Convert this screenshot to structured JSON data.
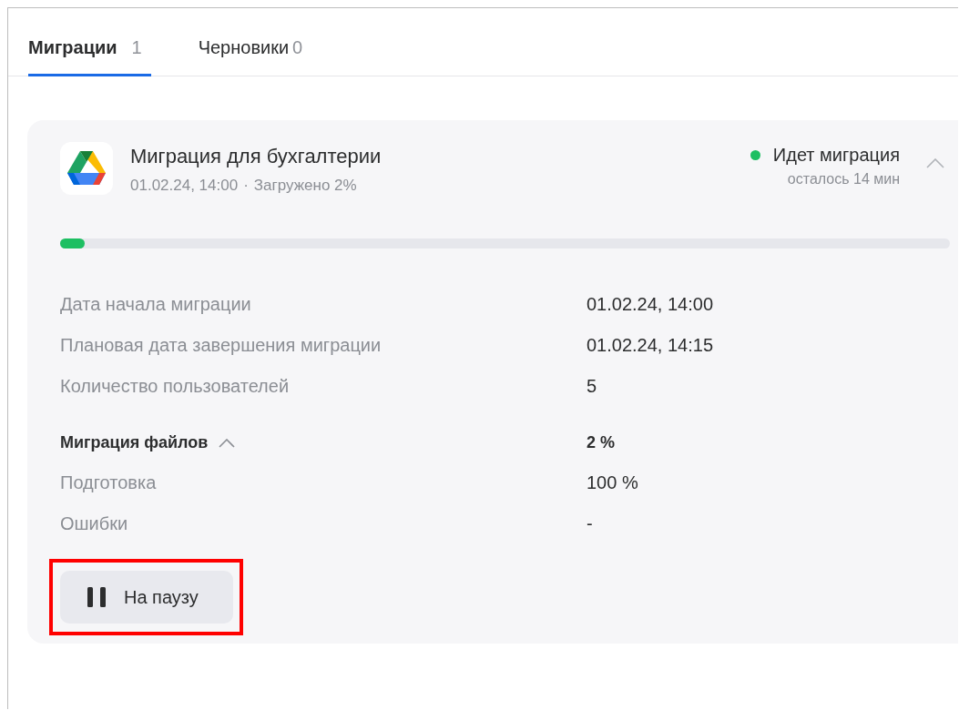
{
  "tabs": [
    {
      "label": "Миграции",
      "count": "1",
      "selected": true
    },
    {
      "label": "Черновики",
      "count": "0",
      "selected": false
    }
  ],
  "migration": {
    "title": "Миграция для бухгалтерии",
    "date": "01.02.24, 14:00",
    "separator": "·",
    "uploaded": "Загружено 2%",
    "status": {
      "label": "Идет миграция",
      "color": "#1dbf62",
      "remaining": "осталось 14 мин"
    },
    "expanded": true,
    "progress": {
      "level": 0.028
    },
    "details": [
      {
        "kind": "row",
        "label": "Дата начала миграции",
        "value": "01.02.24, 14:00"
      },
      {
        "kind": "row",
        "label": "Плановая дата завершения миграции",
        "value": "01.02.24, 14:15"
      },
      {
        "kind": "row",
        "label": "Количество пользователей",
        "value": "5"
      },
      {
        "kind": "section",
        "label": "Миграция файлов",
        "value": "2 %",
        "expanded": true
      },
      {
        "kind": "row",
        "label": "Подготовка",
        "value": "100 %"
      },
      {
        "kind": "row",
        "label": "Ошибки",
        "value": "-"
      }
    ],
    "pause_button": {
      "label": "На паузу",
      "highlighted": true
    }
  }
}
